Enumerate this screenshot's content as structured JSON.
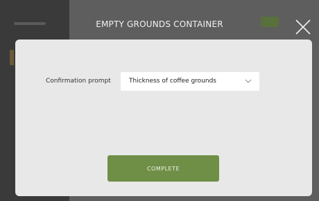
{
  "dialog": {
    "title": "EMPTY GROUNDS CONTAINER",
    "close_icon": "close-icon"
  },
  "form": {
    "prompt_label": "Confirmation prompt",
    "select_value": "Thickness of coffee grounds",
    "select_icon": "chevron-down-icon"
  },
  "actions": {
    "complete_label": "COMPLETE"
  },
  "colors": {
    "accent": "#6f8f47",
    "panel": "#e8e8e8",
    "overlay": "#5e5e5e"
  }
}
